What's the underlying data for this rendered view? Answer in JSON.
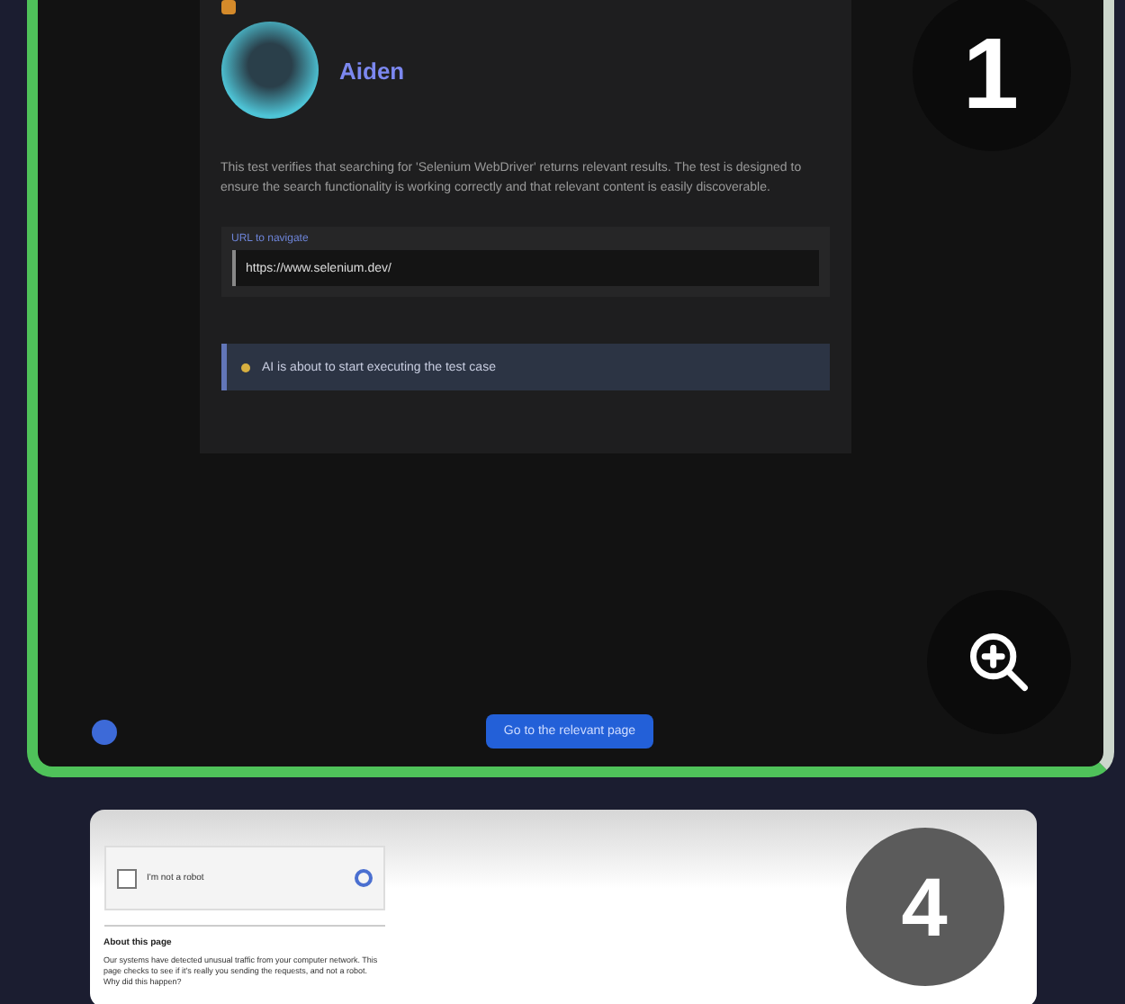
{
  "steps": [
    {
      "number": "1",
      "author": {
        "name": "Aiden"
      },
      "description": "This test verifies that searching for 'Selenium WebDriver' returns relevant results. The test is designed to ensure the search functionality is working correctly and that relevant content is easily discoverable.",
      "url_field": {
        "label": "URL to navigate",
        "value": "https://www.selenium.dev/"
      },
      "status": "AI is about to start executing the test case",
      "action_button": "Go to the relevant page",
      "highlighted": true
    },
    {
      "number": "4",
      "captcha": {
        "checkbox_label": "I'm not a robot",
        "checked": false
      },
      "section_title": "About this page",
      "paragraph": "Our systems have detected unusual traffic from your computer network. This page checks to see if it's really you sending the requests, and not a robot. Why did this happen?",
      "highlighted": false
    }
  ]
}
